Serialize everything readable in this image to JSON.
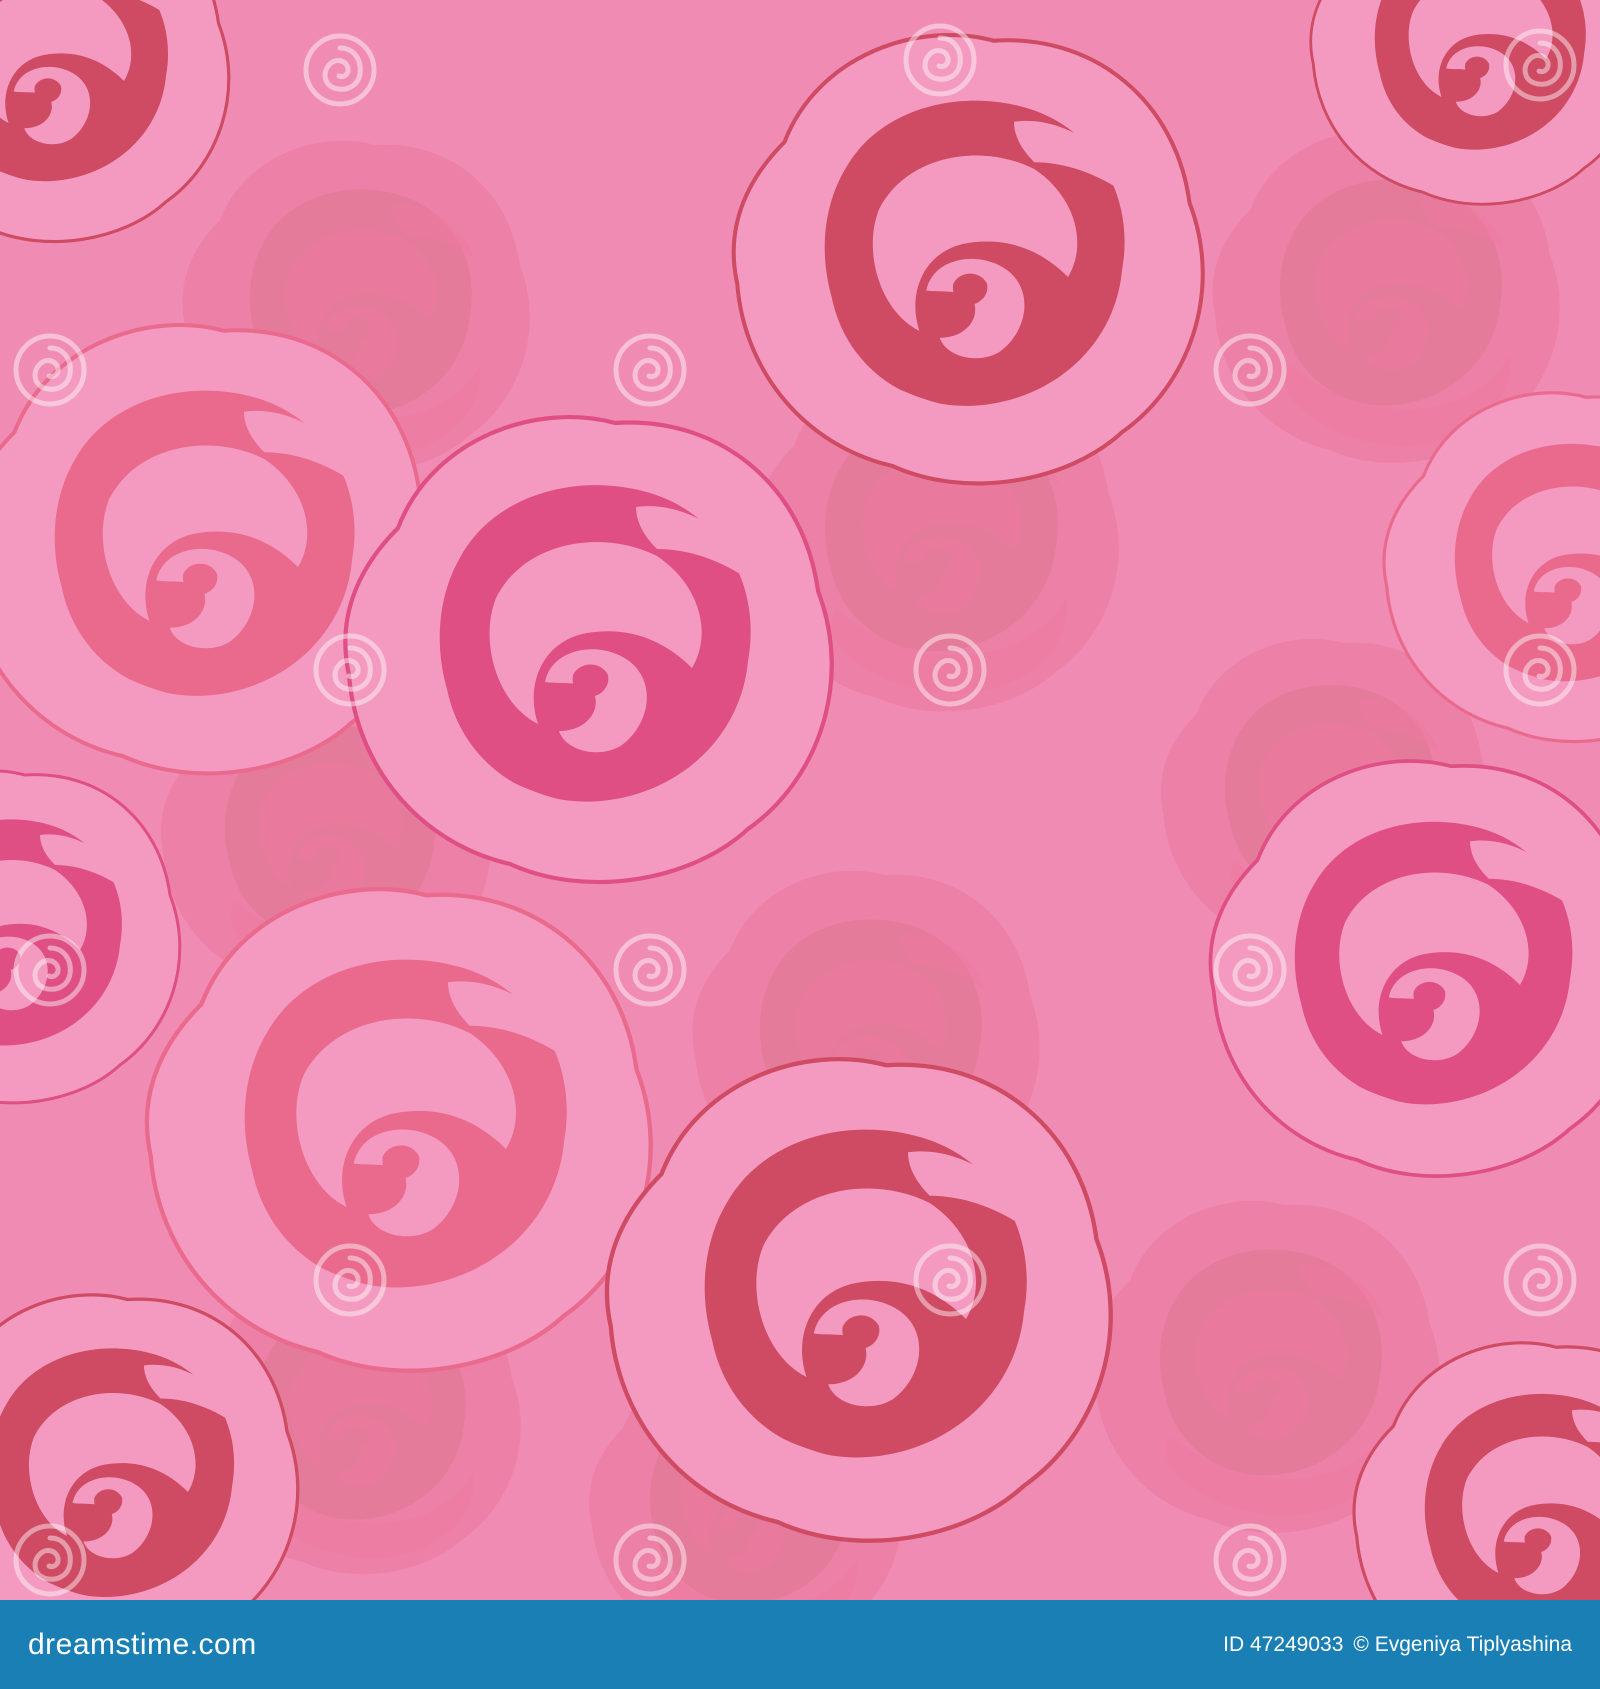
{
  "colors": {
    "background": "#f08cb4",
    "petal_light": "#f49ac0",
    "rose_red": "#cf4a63",
    "rose_magenta": "#df4f83",
    "rose_coral": "#ea6a8e",
    "rose_faded": "#d96f86",
    "footer_bar": "#1a7fb4",
    "footer_text": "#ffffff"
  },
  "watermark": {
    "text": "dreamstime",
    "icon": "spiral-icon"
  },
  "footer": {
    "site": "dreamstime.com",
    "id_label": "ID 47249033",
    "copyright": "© Evgeniya Tiplyashina"
  }
}
